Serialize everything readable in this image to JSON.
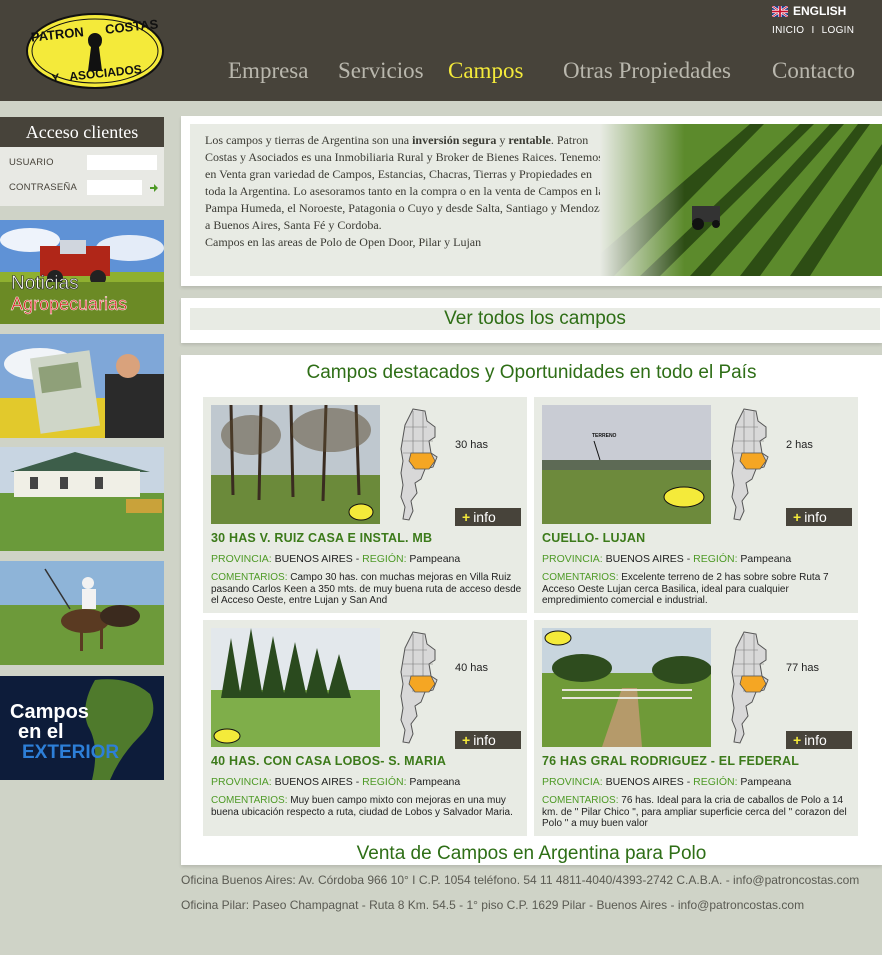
{
  "header": {
    "logo_text_top": "PATRON COSTAS",
    "logo_text_bottom": "Y ASOCIADOS",
    "language": "ENGLISH",
    "top_links": [
      "INICIO",
      "LOGIN"
    ],
    "top_sep": "I",
    "nav": [
      "Empresa",
      "Servicios",
      "Campos",
      "Otras Propiedades",
      "Contacto"
    ],
    "active_nav": "Campos",
    "colors": {
      "bg": "#47433a",
      "active": "#f4ea3a",
      "inactive": "#b9b7ad"
    }
  },
  "sidebar": {
    "login_title": "Acceso clientes",
    "user_label": "USUARIO",
    "pass_label": "CONTRASEÑA",
    "banners": [
      {
        "name": "noticias",
        "line1": "Noticias",
        "line2": "Agropecuarias"
      },
      {
        "name": "diario"
      },
      {
        "name": "casa"
      },
      {
        "name": "polo"
      },
      {
        "name": "exterior",
        "line1": "Campos",
        "line2": "en el",
        "line3": "EXTERIOR"
      }
    ]
  },
  "intro": {
    "p1_a": "Los campos y tierras de Argentina son una ",
    "p1_b": "inversión segura",
    "p1_c": " y ",
    "p1_d": "rentable",
    "p1_e": ". Patron Costas y Asociados es una Inmobiliaria Rural y Broker de Bienes Raices. Tenemos en Venta gran variedad de Campos, Estancias, Chacras, Tierras y Propiedades en toda la Argentina. Lo asesoramos tanto en la compra o en la venta de Campos en la Pampa Humeda, el Noroeste, Patagonia o Cuyo y desde Salta, Santiago y Mendoza a Buenos Aires, Santa Fé y Cordoba.",
    "p2": "Campos en las areas de Polo de Open Door, Pilar y Lujan"
  },
  "ver_todos": "Ver todos los campos",
  "destacados_title": "Campos destacados y Oportunidades en todo el País",
  "labels": {
    "provincia": "PROVINCIA:",
    "region": "REGIÓN:",
    "comentarios": "COMENTARIOS:",
    "info_plus": "+",
    "info": "info",
    "sep": " - "
  },
  "cards": [
    {
      "title": "30 HAS V. RUIZ CASA E INSTAL. MB",
      "has": "30 has",
      "provincia": "BUENOS AIRES",
      "region": "Pampeana",
      "comentario": "Campo 30 has. con muchas mejoras en Villa Ruiz pasando Carlos Keen a 350 mts. de muy buena ruta de acceso desde el Acceso Oeste, entre Lujan y San And"
    },
    {
      "title": "CUELLO- LUJAN",
      "has": "2 has",
      "provincia": "BUENOS AIRES",
      "region": "Pampeana",
      "comentario": "Excelente terreno de 2 has sobre sobre Ruta 7 Acceso Oeste Lujan cerca Basilica, ideal para cualquier empredimiento comercial e industrial.",
      "photo_label": "TERRENO"
    },
    {
      "title": "40 HAS. CON CASA LOBOS- S. MARIA",
      "has": "40 has",
      "provincia": "BUENOS AIRES",
      "region": "Pampeana",
      "comentario": "Muy buen campo mixto con mejoras en una muy buena ubicación respecto a ruta, ciudad de Lobos y Salvador Maria."
    },
    {
      "title": "76 HAS GRAL RODRIGUEZ - EL FEDERAL",
      "has": "77 has",
      "provincia": "BUENOS AIRES",
      "region": "Pampeana",
      "comentario": "76 has. Ideal para la cria de caballos de Polo a 14 km. de \" Pilar Chico \", para ampliar superficie cerca del \" corazon del Polo \" a muy buen valor"
    }
  ],
  "polo_title": "Venta de Campos en Argentina para Polo",
  "footer": {
    "line1": "Oficina Buenos Aires: Av. Córdoba 966 10° I C.P. 1054 teléfono. 54 11 4811-4040/4393-2742 C.A.B.A. - info@patroncostas.com",
    "line2": "Oficina Pilar: Paseo Champagnat - Ruta 8 Km. 54.5 - 1° piso C.P. 1629 Pilar - Buenos Aires - info@patroncostas.com"
  }
}
